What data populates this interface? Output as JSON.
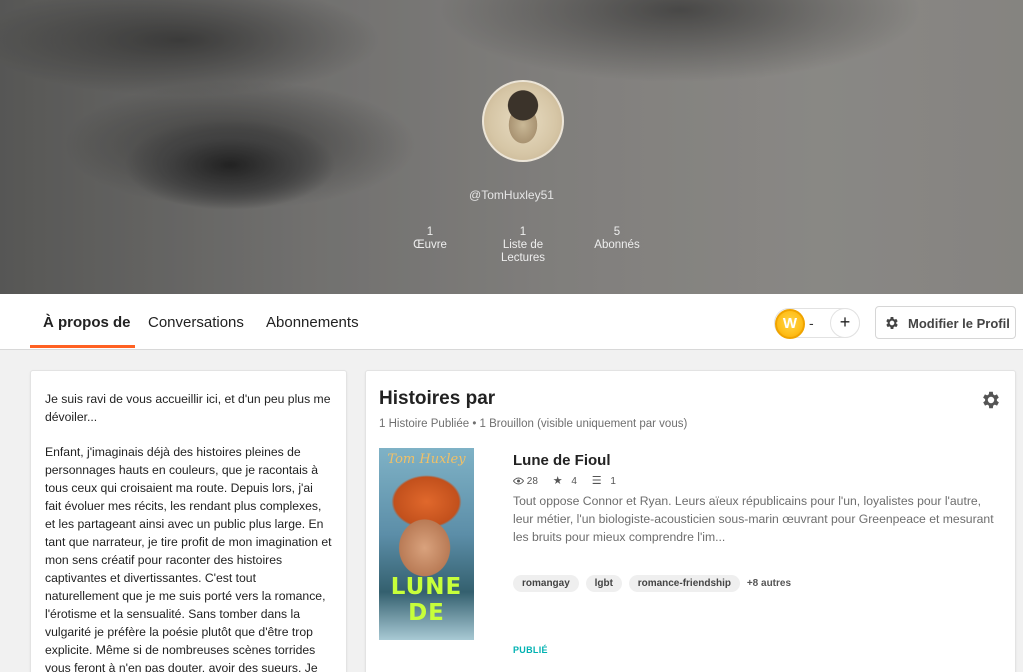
{
  "profile": {
    "username": "@TomHuxley51",
    "stats": [
      {
        "value": "1",
        "label": "Œuvre"
      },
      {
        "value": "1",
        "label": "Liste de Lectures"
      },
      {
        "value": "5",
        "label": "Abonnés"
      }
    ]
  },
  "nav": {
    "tabs": [
      {
        "label": "À propos de",
        "active": true
      },
      {
        "label": "Conversations",
        "active": false
      },
      {
        "label": "Abonnements",
        "active": false
      }
    ],
    "coin_count": "-",
    "plus_label": "+",
    "coin_letter": "W",
    "edit_profile_label": "Modifier le Profil",
    "accent": "#ff6122"
  },
  "about": {
    "paragraphs": [
      "Je suis ravi de vous accueillir ici, et d'un peu plus me dévoiler...",
      "Enfant, j'imaginais déjà des histoires pleines de personnages hauts en couleurs, que je racontais à tous ceux qui croisaient ma route. Depuis lors, j'ai fait évoluer mes récits, les rendant plus complexes, et les partageant ainsi avec un public plus large. En tant que narrateur, je tire profit de mon imagination et mon sens créatif pour raconter des histoires captivantes et divertissantes. C'est tout naturellement que je me suis  porté vers la romance, l'érotisme et la sensualité. Sans tomber dans la vulgarité je préfère la poésie plutôt que d'être trop explicite. Même si de nombreuses scènes torrides vous feront à n'en pas douter, avoir des sueurs. Je"
    ]
  },
  "stories": {
    "title": "Histoires par",
    "subtitle": "1 Histoire Publiée • 1 Brouillon (visible uniquement par vous)",
    "items": [
      {
        "title": "Lune de Fioul",
        "reads": "28",
        "votes": "4",
        "parts": "1",
        "description": "Tout oppose Connor et Ryan. Leurs aïeux républicains pour l'un, loyalistes pour l'autre, leur métier, l'un biologiste-acousticien sous-marin œuvrant pour Greenpeace et mesurant les bruits pour mieux comprendre l'im...",
        "tags": [
          "romangay",
          "lgbt",
          "romance-friendship"
        ],
        "more_tags": "+8 autres",
        "status": "PUBLIÉ",
        "cover_author": "Tom Huxley",
        "cover_title": "LUNE DE"
      }
    ]
  }
}
